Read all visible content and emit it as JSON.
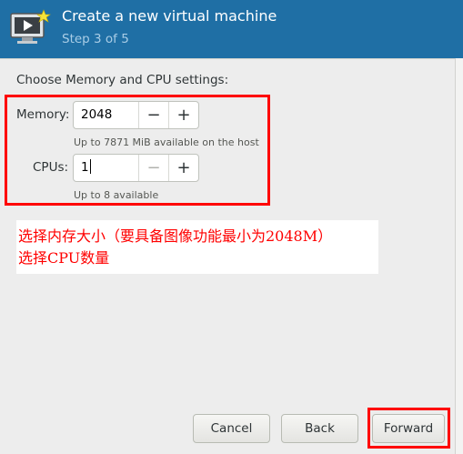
{
  "header": {
    "title": "Create a new virtual machine",
    "subtitle": "Step 3 of 5",
    "icon": "new-vm-icon"
  },
  "section_label": "Choose Memory and CPU settings:",
  "memory": {
    "label": "Memory:",
    "value": "2048",
    "hint": "Up to 7871 MiB available on the host"
  },
  "cpus": {
    "label": "CPUs:",
    "value": "1",
    "hint": "Up to 8 available"
  },
  "annotation": {
    "line1": "选择内存大小（要具备图像功能最小为2048M）",
    "line2": "选择CPU数量",
    "color": "#ff0000"
  },
  "buttons": {
    "cancel": "Cancel",
    "back": "Back",
    "forward": "Forward"
  },
  "colors": {
    "header_bg": "#1f6fa5",
    "highlight": "#ff0000"
  },
  "stepper_symbols": {
    "minus": "−",
    "plus": "+"
  }
}
